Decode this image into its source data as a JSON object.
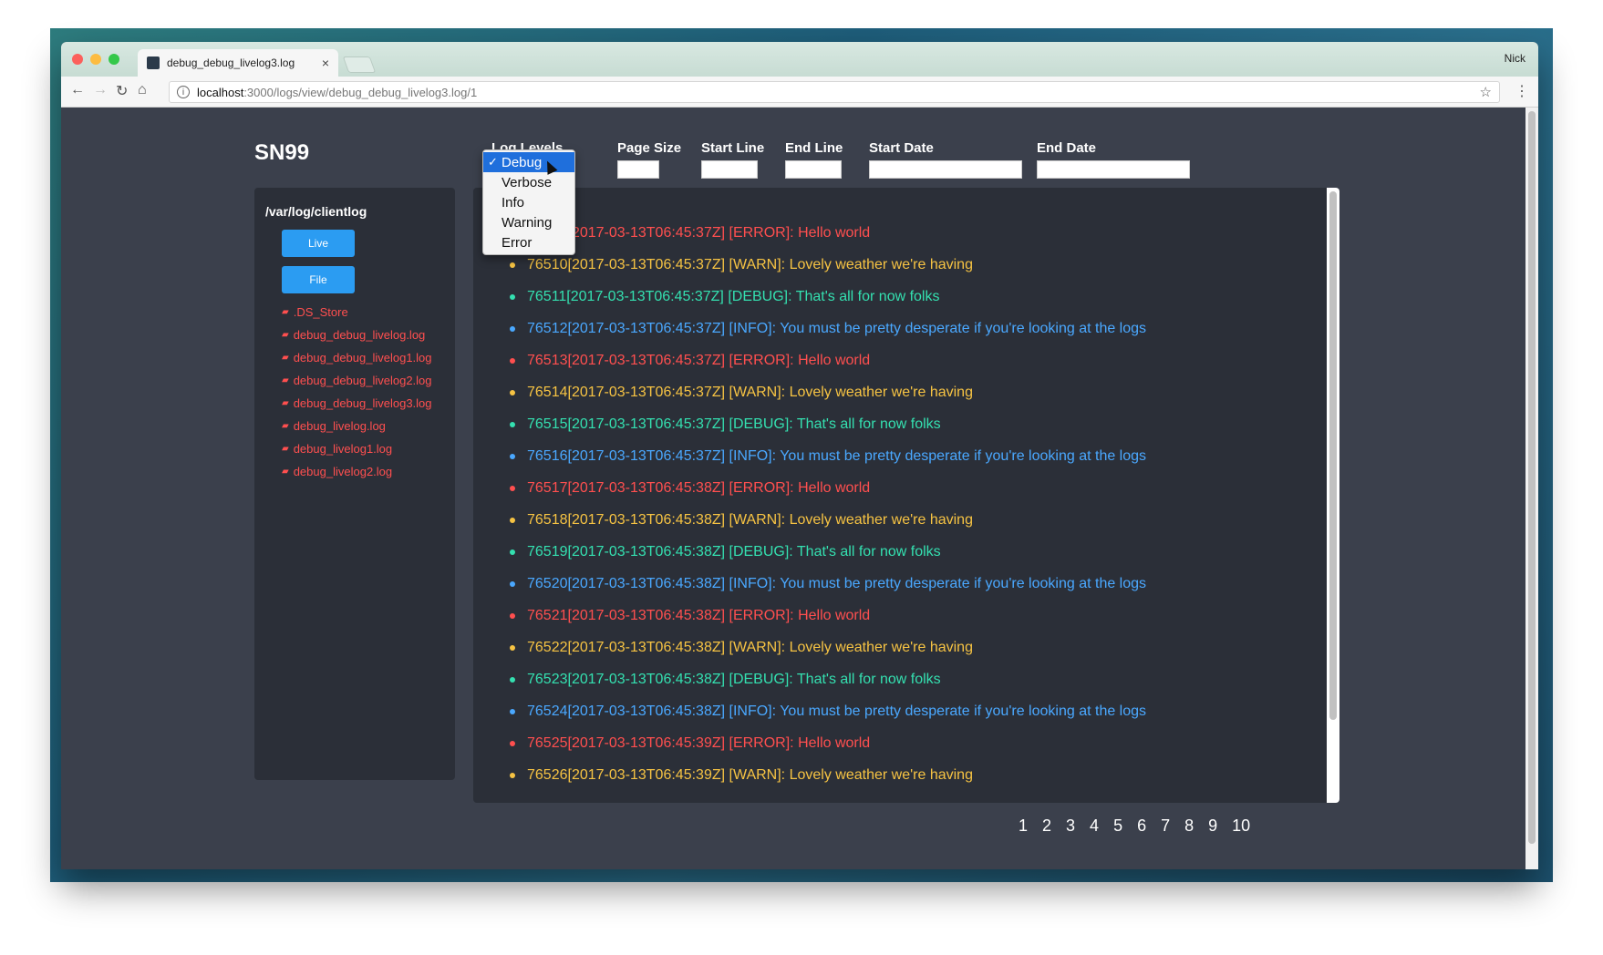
{
  "browser": {
    "tab_title": "debug_debug_livelog3.log",
    "profile_name": "Nick",
    "url_host": "localhost",
    "url_path": ":3000/logs/view/debug_debug_livelog3.log/1"
  },
  "header": {
    "brand": "SN99",
    "log_levels_label": "Log Levels",
    "page_size_label": "Page Size",
    "start_line_label": "Start Line",
    "end_line_label": "End Line",
    "start_date_label": "Start Date",
    "end_date_label": "End Date"
  },
  "log_levels_dropdown": {
    "options": [
      "Debug",
      "Verbose",
      "Info",
      "Warning",
      "Error"
    ],
    "selected": "Debug"
  },
  "sidebar": {
    "path": "/var/log/clientlog",
    "live_button": "Live",
    "file_button": "File",
    "files": [
      ".DS_Store",
      "debug_debug_livelog.log",
      "debug_debug_livelog1.log",
      "debug_debug_livelog2.log",
      "debug_debug_livelog3.log",
      "debug_livelog.log",
      "debug_livelog1.log",
      "debug_livelog2.log"
    ]
  },
  "log_lines": [
    {
      "level": "error",
      "text": "76509[2017-03-13T06:45:37Z] [ERROR]: Hello world"
    },
    {
      "level": "warn",
      "text": "76510[2017-03-13T06:45:37Z] [WARN]: Lovely weather we're having"
    },
    {
      "level": "debug",
      "text": "76511[2017-03-13T06:45:37Z] [DEBUG]: That's all for now folks"
    },
    {
      "level": "info",
      "text": "76512[2017-03-13T06:45:37Z] [INFO]: You must be pretty desperate if you're looking at the logs"
    },
    {
      "level": "error",
      "text": "76513[2017-03-13T06:45:37Z] [ERROR]: Hello world"
    },
    {
      "level": "warn",
      "text": "76514[2017-03-13T06:45:37Z] [WARN]: Lovely weather we're having"
    },
    {
      "level": "debug",
      "text": "76515[2017-03-13T06:45:37Z] [DEBUG]: That's all for now folks"
    },
    {
      "level": "info",
      "text": "76516[2017-03-13T06:45:37Z] [INFO]: You must be pretty desperate if you're looking at the logs"
    },
    {
      "level": "error",
      "text": "76517[2017-03-13T06:45:38Z] [ERROR]: Hello world"
    },
    {
      "level": "warn",
      "text": "76518[2017-03-13T06:45:38Z] [WARN]: Lovely weather we're having"
    },
    {
      "level": "debug",
      "text": "76519[2017-03-13T06:45:38Z] [DEBUG]: That's all for now folks"
    },
    {
      "level": "info",
      "text": "76520[2017-03-13T06:45:38Z] [INFO]: You must be pretty desperate if you're looking at the logs"
    },
    {
      "level": "error",
      "text": "76521[2017-03-13T06:45:38Z] [ERROR]: Hello world"
    },
    {
      "level": "warn",
      "text": "76522[2017-03-13T06:45:38Z] [WARN]: Lovely weather we're having"
    },
    {
      "level": "debug",
      "text": "76523[2017-03-13T06:45:38Z] [DEBUG]: That's all for now folks"
    },
    {
      "level": "info",
      "text": "76524[2017-03-13T06:45:38Z] [INFO]: You must be pretty desperate if you're looking at the logs"
    },
    {
      "level": "error",
      "text": "76525[2017-03-13T06:45:39Z] [ERROR]: Hello world"
    },
    {
      "level": "warn",
      "text": "76526[2017-03-13T06:45:39Z] [WARN]: Lovely weather we're having"
    }
  ],
  "pagination": [
    "1",
    "2",
    "3",
    "4",
    "5",
    "6",
    "7",
    "8",
    "9",
    "10"
  ],
  "colors": {
    "error": "#ff4f4f",
    "warn": "#f6c343",
    "debug": "#34e0b0",
    "info": "#4aa8ff",
    "accent_button": "#2b9cf2"
  }
}
